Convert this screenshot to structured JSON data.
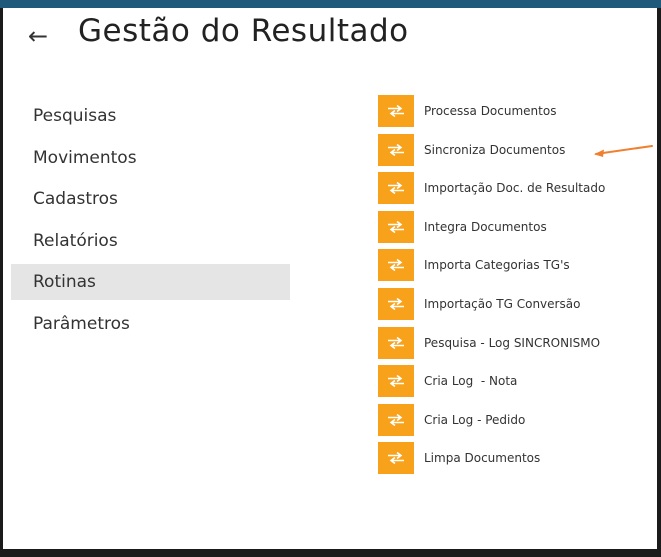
{
  "header": {
    "back_icon": "arrow-left-icon",
    "back_glyph": "←",
    "title": "Gestão do Resultado",
    "accent_color": "#1f5a7a"
  },
  "nav": {
    "items": [
      {
        "label": "Pesquisas",
        "active": false
      },
      {
        "label": "Movimentos",
        "active": false
      },
      {
        "label": "Cadastros",
        "active": false
      },
      {
        "label": "Relatórios",
        "active": false
      },
      {
        "label": "Rotinas",
        "active": true
      },
      {
        "label": "Parâmetros",
        "active": false
      }
    ],
    "active_background": "#e5e5e5"
  },
  "routines": {
    "icon": "swap-arrows-icon",
    "icon_color": "#f7a21a",
    "items": [
      {
        "label": "Processa Documentos"
      },
      {
        "label": "Sincroniza Documentos"
      },
      {
        "label": "Importação Doc. de Resultado"
      },
      {
        "label": "Integra Documentos"
      },
      {
        "label": "Importa Categorias TG's"
      },
      {
        "label": "Importação TG Conversão"
      },
      {
        "label": "Pesquisa - Log SINCRONISMO"
      },
      {
        "label": "Cria Log  - Nota"
      },
      {
        "label": "Cria Log - Pedido"
      },
      {
        "label": "Limpa Documentos"
      }
    ]
  },
  "annotation": {
    "icon": "annotation-arrow-icon",
    "color": "#f08030",
    "points_to": "Sincroniza Documentos"
  }
}
